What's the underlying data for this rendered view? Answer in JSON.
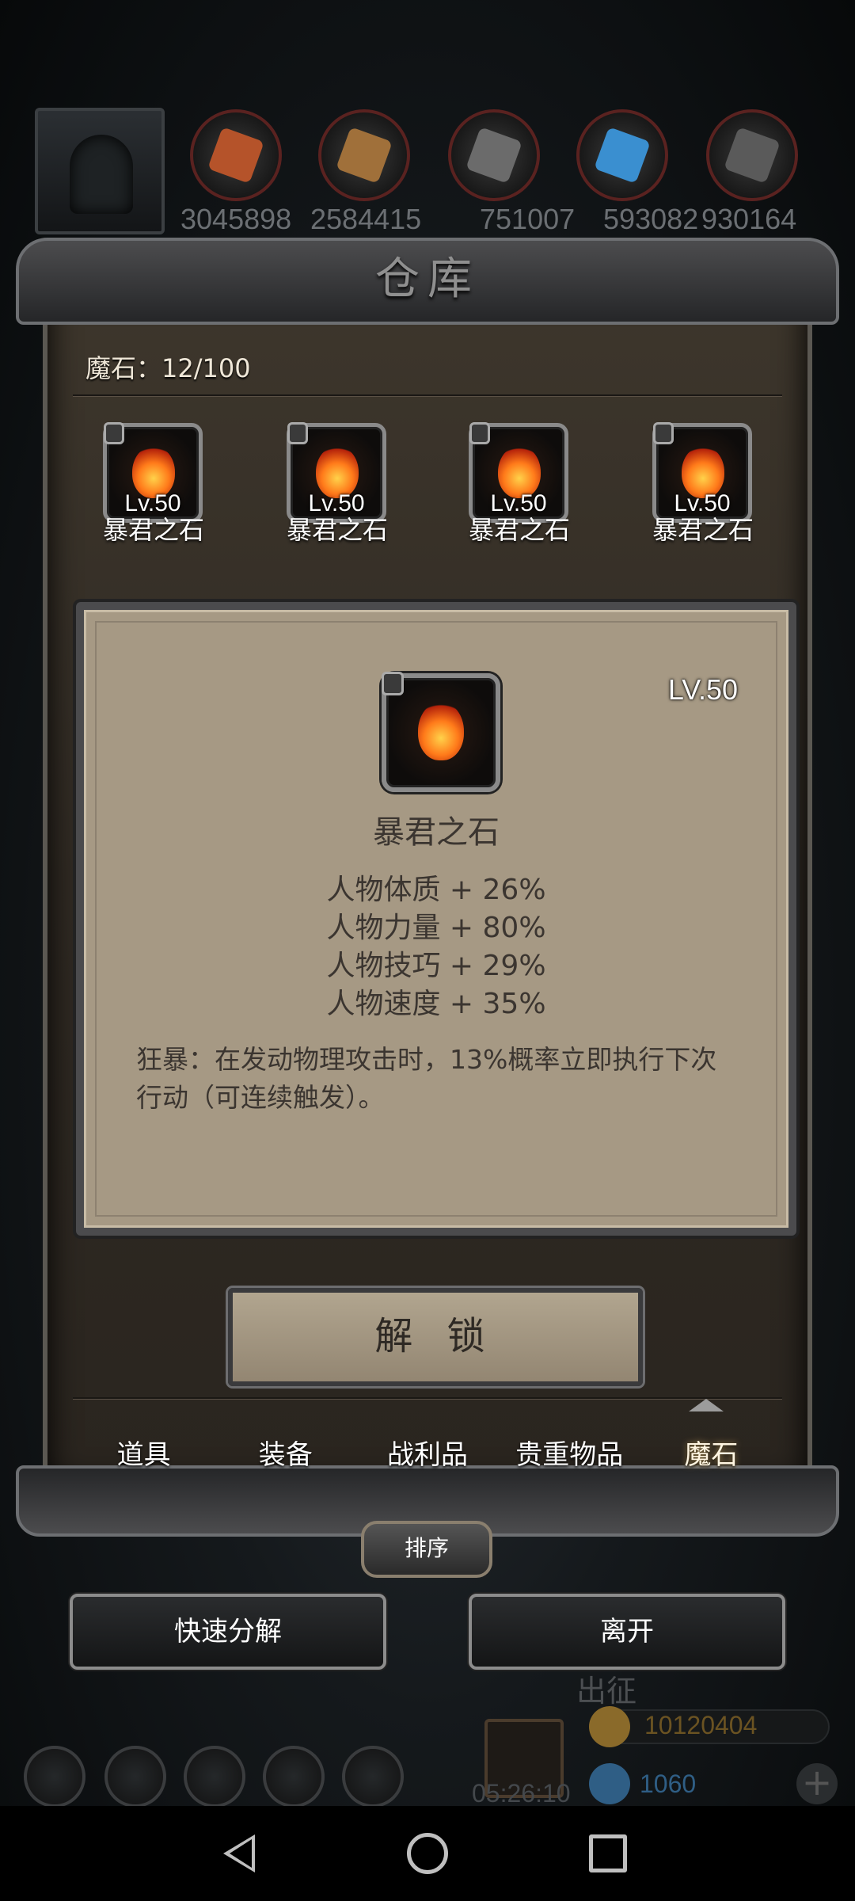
{
  "resources": [
    "3045898",
    "2584415",
    "751007",
    "593082",
    "930164"
  ],
  "resource_colors": [
    "#b5532a",
    "#a0703a",
    "#6b6b6b",
    "#3a8fd0",
    "#5a5a5a"
  ],
  "warehouse": {
    "title": "仓库",
    "capacity_label": "魔石：12/100"
  },
  "items": [
    {
      "level": "Lv.50",
      "name": "暴君之石"
    },
    {
      "level": "Lv.50",
      "name": "暴君之石"
    },
    {
      "level": "Lv.50",
      "name": "暴君之石"
    },
    {
      "level": "Lv.50",
      "name": "暴君之石"
    }
  ],
  "detail": {
    "level": "LV.50",
    "name": "暴君之石",
    "stats": [
      "人物体质 + 26%",
      "人物力量 + 80%",
      "人物技巧 + 29%",
      "人物速度 + 35%"
    ],
    "description": "狂暴：在发动物理攻击时，13%概率立即执行下次行动（可连续触发）。"
  },
  "unlock_button": "解 锁",
  "tabs": [
    {
      "label": "道具",
      "active": false
    },
    {
      "label": "装备",
      "active": false
    },
    {
      "label": "战利品",
      "active": false
    },
    {
      "label": "贵重物品",
      "active": false
    },
    {
      "label": "魔石",
      "active": true
    }
  ],
  "sort_button": "排序",
  "quick_decompose_button": "快速分解",
  "leave_button": "离开",
  "hud": {
    "expedition_label": "出征",
    "timer": "05:26:10",
    "gold": "10120404",
    "gems": "1060",
    "gold_color": "#8a6a2a",
    "gem_color": "#2f5e85"
  },
  "icons": {
    "back": "back-triangle-icon",
    "home": "home-circle-icon",
    "recent": "recent-square-icon"
  }
}
